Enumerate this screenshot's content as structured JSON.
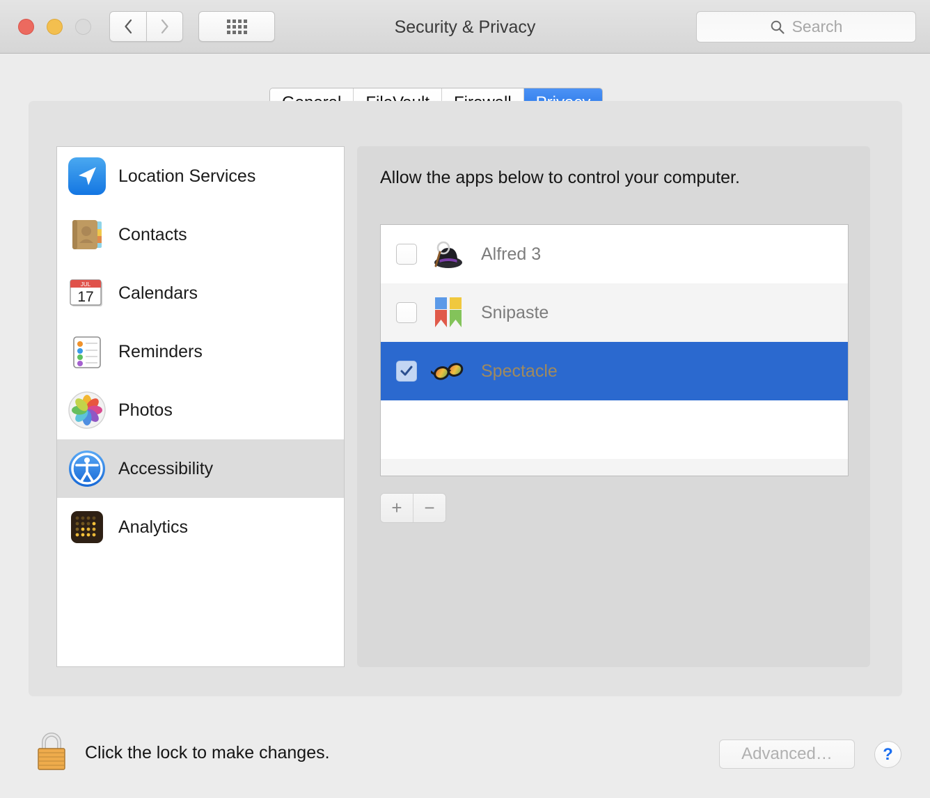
{
  "titlebar": {
    "title": "Security & Privacy",
    "back_icon": "chevron-left-icon",
    "forward_icon": "chevron-right-icon",
    "grid_icon": "show-all-grid-icon",
    "search": {
      "placeholder": "Search",
      "icon": "search-icon",
      "value": ""
    },
    "window_controls": {
      "close": "close-button",
      "minimize": "minimize-button",
      "zoom": "zoom-button"
    }
  },
  "tabs": [
    {
      "label": "General",
      "active": false
    },
    {
      "label": "FileVault",
      "active": false
    },
    {
      "label": "Firewall",
      "active": false
    },
    {
      "label": "Privacy",
      "active": true
    }
  ],
  "sidebar": {
    "items": [
      {
        "label": "Location Services",
        "icon": "location-services-icon",
        "selected": false
      },
      {
        "label": "Contacts",
        "icon": "contacts-icon",
        "selected": false
      },
      {
        "label": "Calendars",
        "icon": "calendars-icon",
        "selected": false
      },
      {
        "label": "Reminders",
        "icon": "reminders-icon",
        "selected": false
      },
      {
        "label": "Photos",
        "icon": "photos-icon",
        "selected": false
      },
      {
        "label": "Accessibility",
        "icon": "accessibility-icon",
        "selected": true
      },
      {
        "label": "Analytics",
        "icon": "analytics-icon",
        "selected": false
      }
    ]
  },
  "detail": {
    "description": "Allow the apps below to control your computer.",
    "apps": [
      {
        "name": "Alfred 3",
        "icon": "alfred-hat-icon",
        "checked": false,
        "selected": false
      },
      {
        "name": "Snipaste",
        "icon": "snipaste-icon",
        "checked": false,
        "selected": false
      },
      {
        "name": "Spectacle",
        "icon": "spectacle-glasses-icon",
        "checked": true,
        "selected": true
      }
    ],
    "add_button": "+",
    "remove_button": "−"
  },
  "footer": {
    "lock_icon": "padlock-closed-icon",
    "lock_message": "Click the lock to make changes.",
    "advanced_label": "Advanced…",
    "advanced_enabled": false,
    "help_label": "?"
  },
  "colors": {
    "accent_blue": "#2272e4",
    "selection_blue": "#2b69cf",
    "window_bg": "#ececec",
    "panel_bg": "#e2e2e2"
  }
}
